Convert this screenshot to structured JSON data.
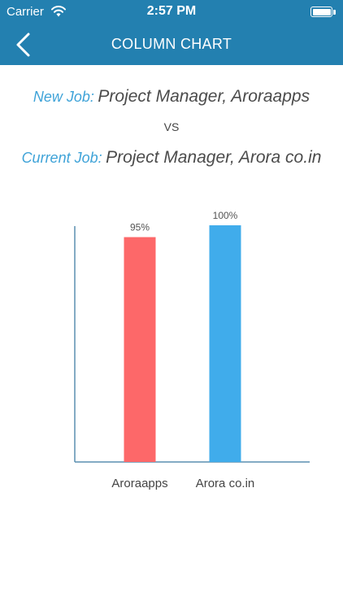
{
  "status_bar": {
    "carrier": "Carrier",
    "time": "2:57 PM",
    "icons": [
      "wifi-icon",
      "battery-icon"
    ]
  },
  "nav": {
    "title": "COLUMN CHART",
    "back_icon": "chevron-left-icon"
  },
  "comparison": {
    "new_job_label": "New Job:",
    "new_job_value": "Project Manager, Aroraapps",
    "vs_text": "VS",
    "current_job_label": "Current Job:",
    "current_job_value": "Project Manager, Arora co.in"
  },
  "colors": {
    "header_bg": "#2380b0",
    "label_blue": "#3fa3d8",
    "bar_red": "#fd6869",
    "bar_blue": "#40aceb",
    "axis": "#5a8fb0"
  },
  "chart_data": {
    "type": "bar",
    "categories": [
      "Aroraapps",
      "Arora co.in"
    ],
    "values": [
      95,
      100
    ],
    "data_labels": [
      "95%",
      "100%"
    ],
    "ylim": [
      0,
      100
    ],
    "grid": false,
    "bar_colors": [
      "#fd6869",
      "#40aceb"
    ]
  }
}
